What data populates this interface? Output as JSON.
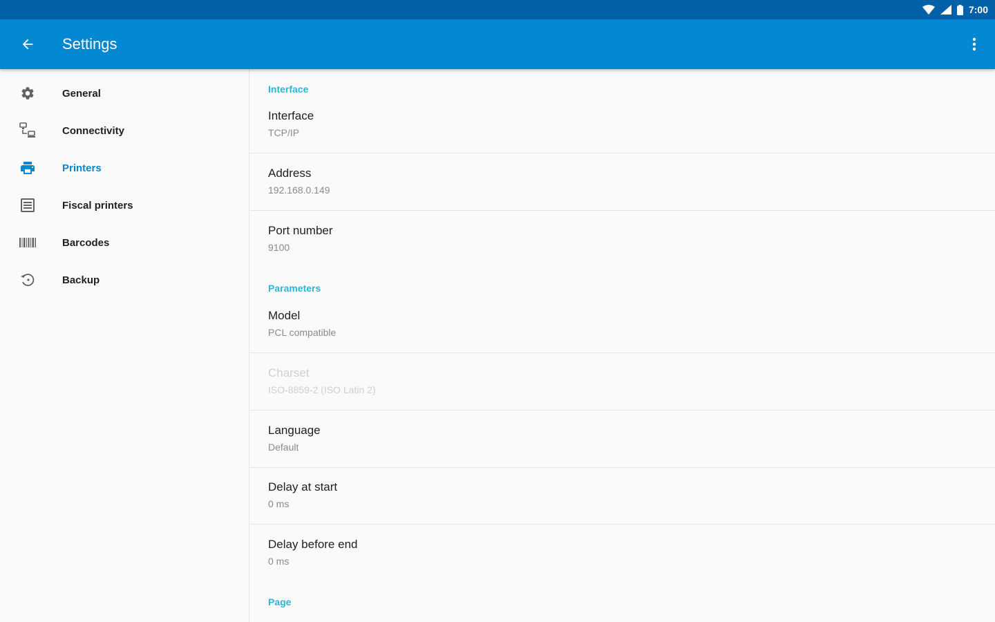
{
  "status_bar": {
    "time": "7:00"
  },
  "app_bar": {
    "title": "Settings"
  },
  "sidebar": {
    "items": [
      {
        "label": "General",
        "icon": "gear-icon"
      },
      {
        "label": "Connectivity",
        "icon": "connectivity-icon"
      },
      {
        "label": "Printers",
        "icon": "printer-icon",
        "active": true
      },
      {
        "label": "Fiscal printers",
        "icon": "fiscal-printer-icon"
      },
      {
        "label": "Barcodes",
        "icon": "barcode-icon"
      },
      {
        "label": "Backup",
        "icon": "backup-restore-icon"
      }
    ]
  },
  "content": {
    "sections": [
      {
        "header": "Interface",
        "items": [
          {
            "title": "Interface",
            "summary": "TCP/IP"
          },
          {
            "title": "Address",
            "summary": "192.168.0.149"
          },
          {
            "title": "Port number",
            "summary": "9100"
          }
        ]
      },
      {
        "header": "Parameters",
        "items": [
          {
            "title": "Model",
            "summary": "PCL compatible"
          },
          {
            "title": "Charset",
            "summary": "ISO-8859-2 (ISO Latin 2)",
            "disabled": true
          },
          {
            "title": "Language",
            "summary": "Default"
          },
          {
            "title": "Delay at start",
            "summary": "0 ms"
          },
          {
            "title": "Delay before end",
            "summary": "0 ms"
          }
        ]
      },
      {
        "header": "Page",
        "items": []
      }
    ]
  },
  "colors": {
    "status_bar": "#0161a8",
    "app_bar": "#0288d1",
    "accent": "#0288d1",
    "section_header": "#29b6d8"
  }
}
